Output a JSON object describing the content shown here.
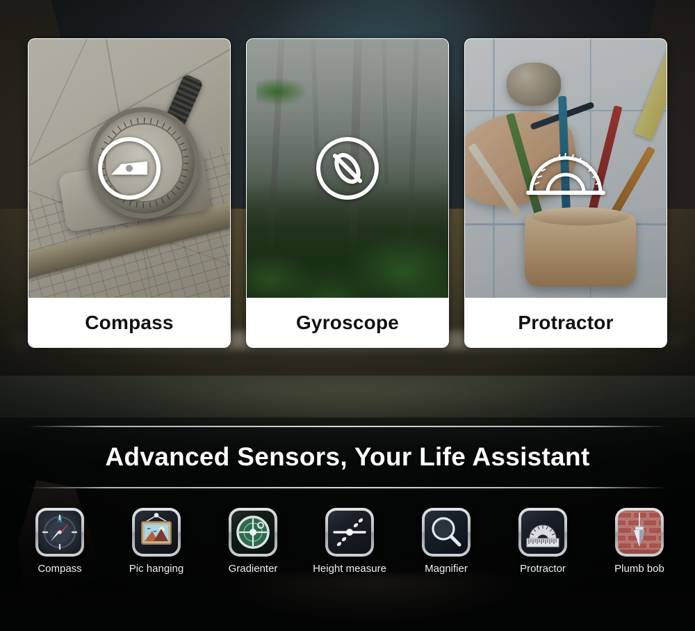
{
  "cards": [
    {
      "label": "Compass",
      "icon": "compass-outline-icon",
      "photo": "compass-on-map-photo"
    },
    {
      "label": "Gyroscope",
      "icon": "gyroscope-outline-icon",
      "photo": "misty-forest-photo"
    },
    {
      "label": "Protractor",
      "icon": "protractor-outline-icon",
      "photo": "desk-with-pencils-photo"
    }
  ],
  "headline": {
    "text": "Advanced Sensors, Your Life Assistant"
  },
  "apps": [
    {
      "name": "Compass",
      "icon": "compass-app-icon"
    },
    {
      "name": "Pic hanging",
      "icon": "picture-frame-app-icon"
    },
    {
      "name": "Gradienter",
      "icon": "bubble-level-app-icon"
    },
    {
      "name": "Height measure",
      "icon": "height-measure-app-icon"
    },
    {
      "name": "Magnifier",
      "icon": "magnifier-app-icon"
    },
    {
      "name": "Protractor",
      "icon": "protractor-app-icon"
    },
    {
      "name": "Plumb bob",
      "icon": "plumb-bob-app-icon"
    }
  ],
  "colors": {
    "card_background": "#ffffff",
    "card_label_text": "#111111",
    "headline_text": "#ffffff",
    "page_background": "#0a0c0b",
    "app_label_text": "#f2f2f2",
    "compass_needle_red": "#d83a32",
    "compass_north_cyan": "#2fd0e0",
    "gradienter_green": "#2f6b4a",
    "plumb_brick_red": "#9c4b46"
  }
}
